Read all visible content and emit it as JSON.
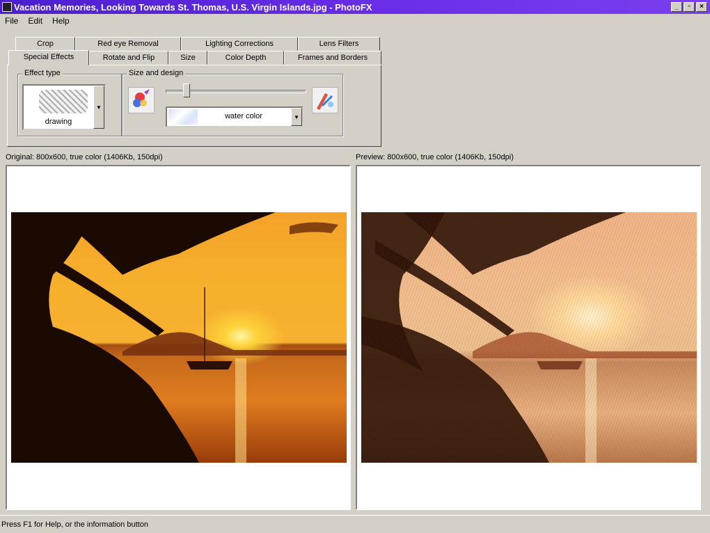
{
  "window": {
    "title": "Vacation Memories, Looking Towards St. Thomas, U.S. Virgin Islands.jpg - PhotoFX",
    "controls": [
      "_",
      "▫",
      "×"
    ]
  },
  "menu": [
    "File",
    "Edit",
    "Help"
  ],
  "tabs": {
    "row1": [
      "Crop",
      "Red eye Removal",
      "Lighting Corrections",
      "Lens Filters"
    ],
    "row2": [
      "Special Effects",
      "Rotate and Flip",
      "Size",
      "Color Depth",
      "Frames and Borders"
    ],
    "active": "Special Effects"
  },
  "effect_type": {
    "legend": "Effect type",
    "value": "drawing"
  },
  "size_design": {
    "legend": "Size and design",
    "style_value": "water color",
    "slider_level": 0.15
  },
  "side_buttons": [
    "U",
    "i"
  ],
  "original": {
    "caption": "Original: 800x600, true color (1406Kb, 150dpi)"
  },
  "preview": {
    "caption": "Preview: 800x600, true color (1406Kb, 150dpi)"
  },
  "status": "Press F1 for Help, or the information button",
  "colors": {
    "titlebar": "#5a26dc",
    "face": "#d4d0c8"
  }
}
